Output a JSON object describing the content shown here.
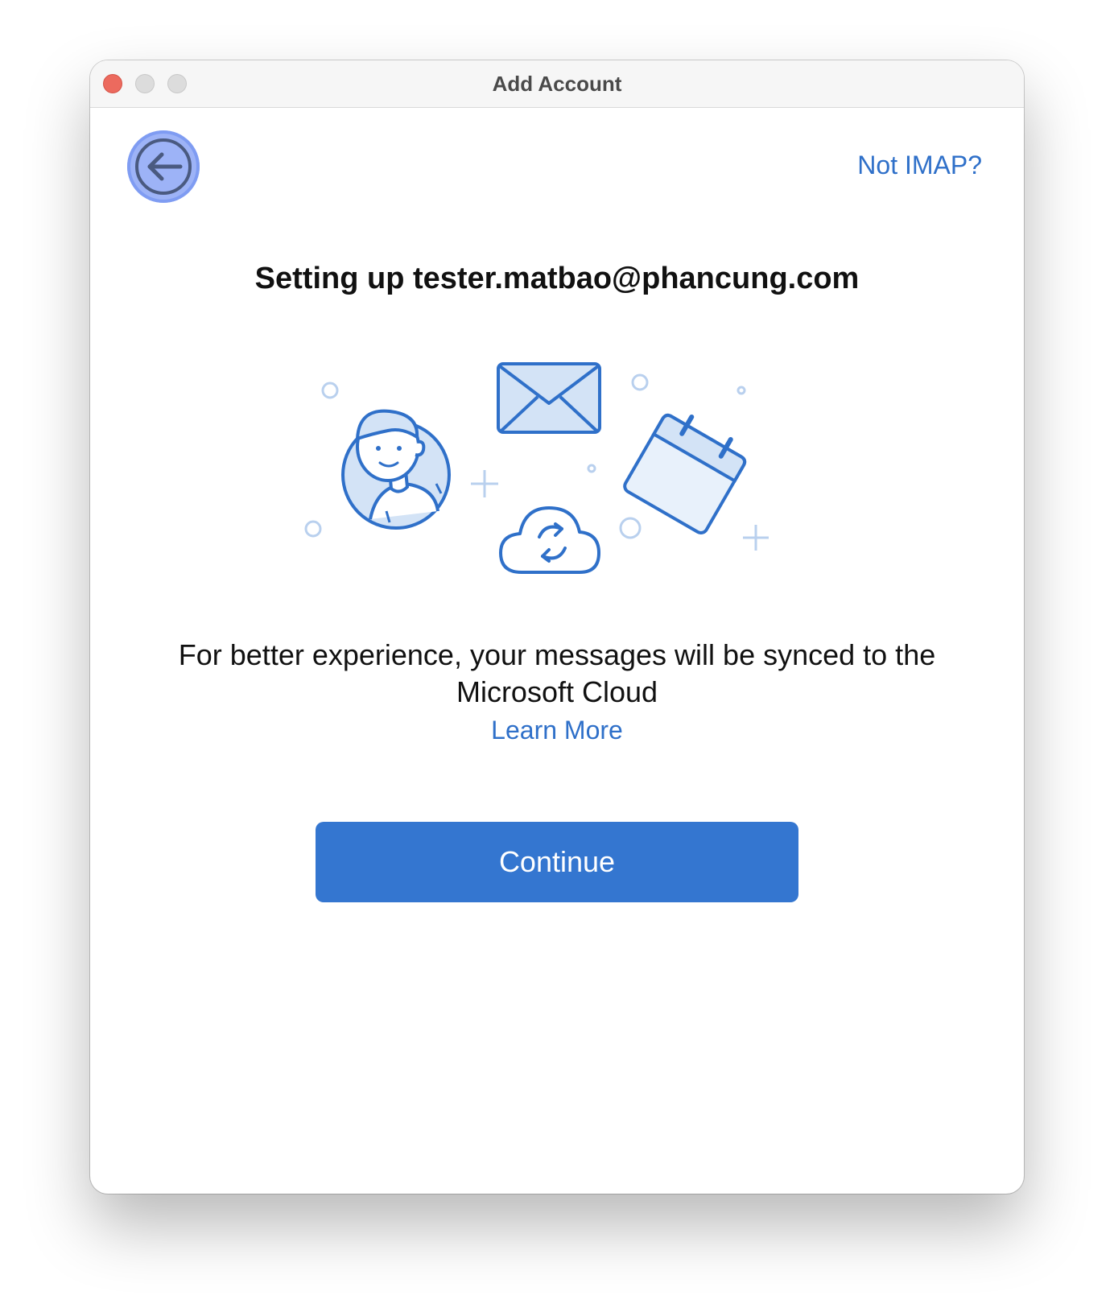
{
  "window": {
    "title": "Add Account"
  },
  "header": {
    "not_imap_label": "Not IMAP?"
  },
  "main": {
    "setup_title": "Setting up tester.matbao@phancung.com",
    "description": "For better experience, your messages will be synced to the Microsoft Cloud",
    "learn_more_label": "Learn More",
    "continue_label": "Continue"
  },
  "icons": {
    "back": "back-arrow-icon",
    "person": "person-icon",
    "mail": "envelope-icon",
    "calendar": "calendar-icon",
    "cloud_sync": "cloud-sync-icon"
  },
  "colors": {
    "accent": "#3476d0",
    "link": "#2f70c9",
    "illustration_stroke": "#2f70c9",
    "illustration_fill": "#d3e3f6",
    "back_button_fill": "#9db3f7",
    "close_dot": "#ec6a5e"
  }
}
